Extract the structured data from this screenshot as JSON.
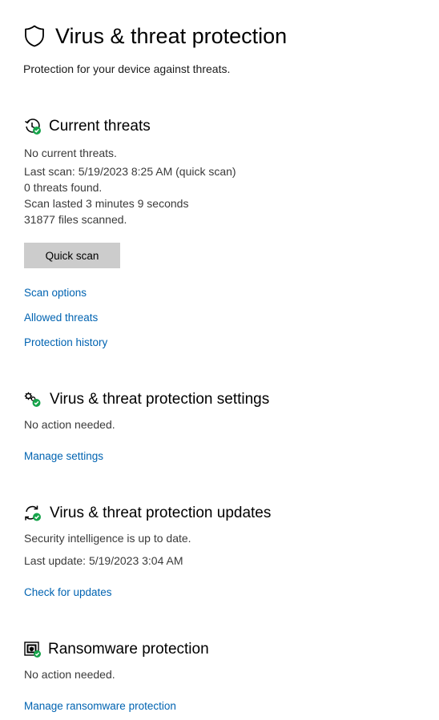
{
  "page": {
    "title": "Virus & threat protection",
    "subtitle": "Protection for your device against threats."
  },
  "current_threats": {
    "title": "Current threats",
    "status": "No current threats.",
    "last_scan": "Last scan: 5/19/2023 8:25 AM (quick scan)",
    "threats_found": "0 threats found.",
    "duration": "Scan lasted 3 minutes 9 seconds",
    "files_scanned": "31877 files scanned.",
    "quick_scan_label": "Quick scan",
    "links": {
      "scan_options": "Scan options",
      "allowed_threats": "Allowed threats",
      "protection_history": "Protection history"
    }
  },
  "settings": {
    "title": "Virus & threat protection settings",
    "status": "No action needed.",
    "link": "Manage settings"
  },
  "updates": {
    "title": "Virus & threat protection updates",
    "status": "Security intelligence is up to date.",
    "last_update": "Last update: 5/19/2023 3:04 AM",
    "link": "Check for updates"
  },
  "ransomware": {
    "title": "Ransomware protection",
    "status": "No action needed.",
    "link": "Manage ransomware protection"
  },
  "icons": {
    "header": "shield-icon",
    "current_threats": "history-check-icon",
    "settings": "gears-check-icon",
    "updates": "refresh-check-icon",
    "ransomware": "folder-shield-check-icon"
  },
  "colors": {
    "link": "#0063b1",
    "status_ok": "#16a34a",
    "button_bg": "#cccccc"
  }
}
